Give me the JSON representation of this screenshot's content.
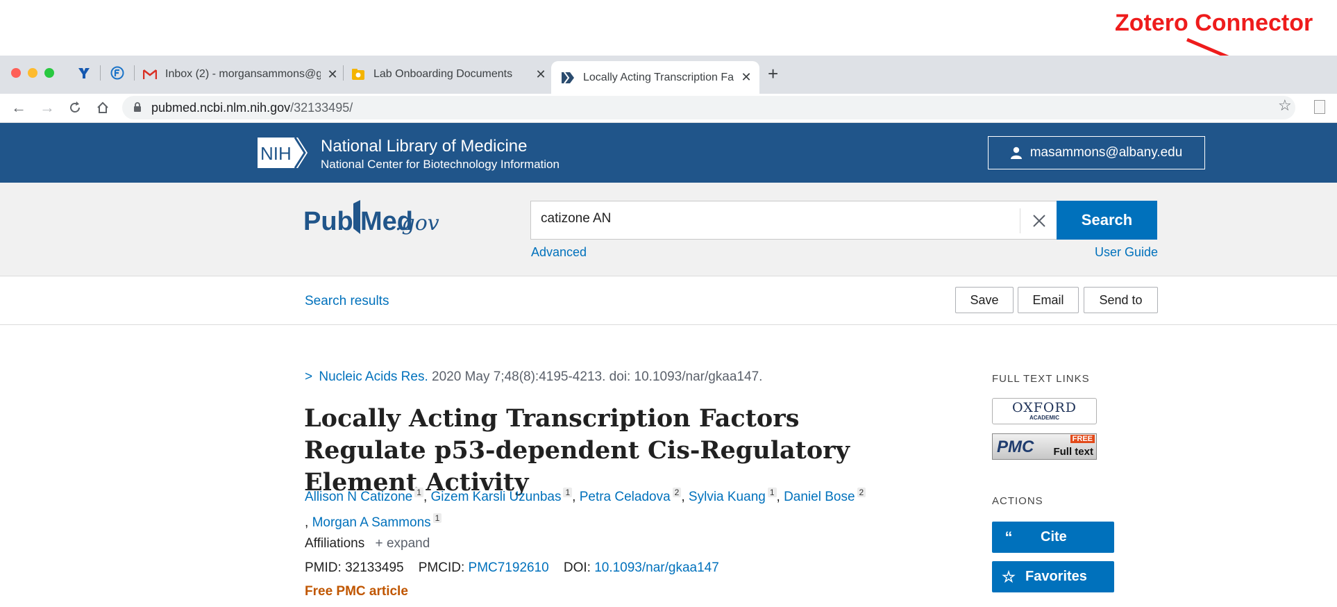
{
  "annotation": {
    "label": "Zotero Connector",
    "color": "#ee1c1c"
  },
  "browser": {
    "tabs": [
      {
        "title": "Inbox (2) - morgansammons@g",
        "icon": "gmail-icon"
      },
      {
        "title": "Lab Onboarding Documents",
        "icon": "drive-folder-icon"
      },
      {
        "title": "Locally Acting Transcription Fa",
        "icon": "pubmed-tab-icon",
        "active": true
      }
    ],
    "pinned_icons": [
      "yahoo-icon",
      "firefox-account-icon"
    ],
    "url_host": "pubmed.ncbi.nlm.nih.gov",
    "url_path": "/32133495/"
  },
  "nih": {
    "logo": "NIH",
    "title": "National Library of Medicine",
    "subtitle": "National Center for Biotechnology Information",
    "account": "masammons@albany.edu"
  },
  "search": {
    "logo_pub": "Pub",
    "logo_med": "Med",
    "logo_gov": ".gov",
    "query": "catizone AN",
    "button": "Search",
    "advanced": "Advanced",
    "user_guide": "User Guide"
  },
  "results_bar": {
    "search_results": "Search results",
    "save": "Save",
    "email": "Email",
    "send_to": "Send to"
  },
  "article": {
    "journal": "Nucleic Acids Res.",
    "citation": " 2020 May 7;48(8):4195-4213. doi: 10.1093/nar/gkaa147.",
    "title": "Locally Acting Transcription Factors Regulate p53-dependent Cis-Regulatory Element Activity",
    "authors": [
      {
        "name": "Allison N Catizone",
        "aff": "1"
      },
      {
        "name": "Gizem Karsli Uzunbas",
        "aff": "1"
      },
      {
        "name": "Petra Celadova",
        "aff": "2"
      },
      {
        "name": "Sylvia Kuang",
        "aff": "1"
      },
      {
        "name": "Daniel Bose",
        "aff": "2"
      },
      {
        "name": "Morgan A Sammons",
        "aff": "1"
      }
    ],
    "affiliations_label": "Affiliations",
    "expand_label": "expand",
    "pmid_label": "PMID: ",
    "pmid": "32133495",
    "pmcid_label": "PMCID: ",
    "pmcid": "PMC7192610",
    "doi_label": "DOI: ",
    "doi": "10.1093/nar/gkaa147",
    "free_pmc": "Free PMC article"
  },
  "sidebar": {
    "full_text_links": "FULL TEXT LINKS",
    "oxford_main": "OXFORD",
    "oxford_sub": "ACADEMIC",
    "pmc_text": "PMC",
    "pmc_free": "FREE",
    "pmc_full": "Full text",
    "actions": "ACTIONS",
    "cite": "Cite",
    "favorites": "Favorites"
  }
}
